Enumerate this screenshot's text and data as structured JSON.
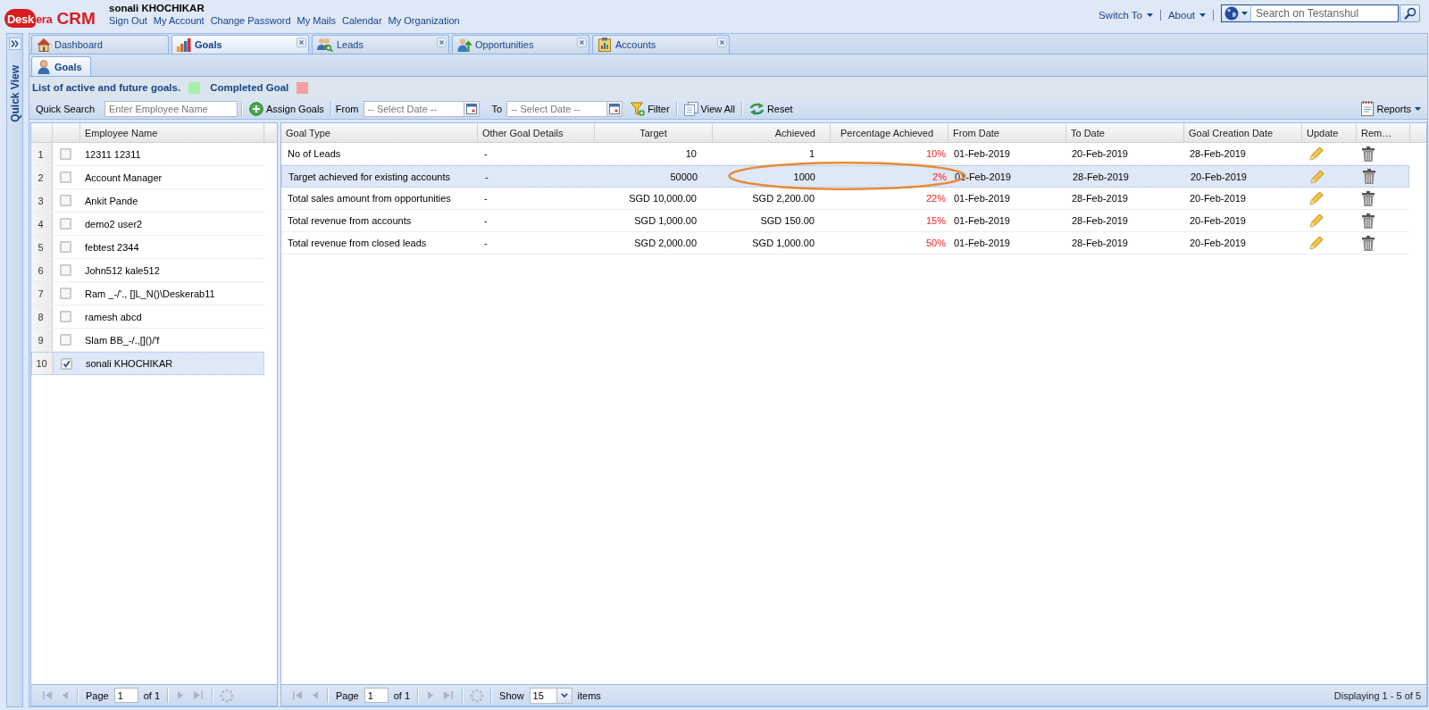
{
  "header": {
    "logo_mark": "Desk",
    "logo_text": "era",
    "product": "CRM",
    "user": "sonali KHOCHIKAR",
    "links": [
      "Sign Out",
      "My Account",
      "Change Password",
      "My Mails",
      "Calendar",
      "My Organization"
    ],
    "menus": [
      "Switch To",
      "About"
    ],
    "search": {
      "placeholder": "Search on Testanshul"
    }
  },
  "quick_view": {
    "title": "Quick View"
  },
  "tabs": [
    {
      "label": "Dashboard",
      "kind": "house",
      "closable": false,
      "selected": false
    },
    {
      "label": "Goals",
      "kind": "bar-chart",
      "closable": true,
      "selected": true
    },
    {
      "label": "Leads",
      "kind": "people",
      "closable": true,
      "selected": false
    },
    {
      "label": "Opportunities",
      "kind": "person-arrow",
      "closable": true,
      "selected": false
    },
    {
      "label": "Accounts",
      "kind": "clipboard",
      "closable": true,
      "selected": false
    }
  ],
  "subtabs": [
    {
      "label": "Goals",
      "selected": true
    }
  ],
  "legend": [
    {
      "label": "List of active and future goals.",
      "color": "#a8f0a8"
    },
    {
      "label": "Completed Goal",
      "color": "#f2a0a0"
    }
  ],
  "toolbar": {
    "search_label": "Quick Search",
    "search_placeholder": "Enter Employee Name",
    "assign": "Assign Goals",
    "from_label": "From",
    "from_placeholder": "-- Select Date --",
    "to_label": "To",
    "to_placeholder": "-- Select Date --",
    "filter": "Filter",
    "view_all": "View All",
    "reset": "Reset",
    "reports": "Reports"
  },
  "employees": {
    "columns": [
      "Employee Name"
    ],
    "rows": [
      {
        "number": "1",
        "name": "12311 12311",
        "checked": false,
        "selected": false
      },
      {
        "number": "2",
        "name": "Account Manager",
        "checked": false,
        "selected": false
      },
      {
        "number": "3",
        "name": "Ankit Pande",
        "checked": false,
        "selected": false
      },
      {
        "number": "4",
        "name": "demo2 user2",
        "checked": false,
        "selected": false
      },
      {
        "number": "5",
        "name": "febtest 2344",
        "checked": false,
        "selected": false
      },
      {
        "number": "6",
        "name": "John512 kale512",
        "checked": false,
        "selected": false
      },
      {
        "number": "7",
        "name": "Ram _-/'., []L_N()\\Deskerab11",
        "checked": false,
        "selected": false
      },
      {
        "number": "8",
        "name": "ramesh abcd",
        "checked": false,
        "selected": false
      },
      {
        "number": "9",
        "name": "Slam BB_-/.,[]()/'f",
        "checked": false,
        "selected": false
      },
      {
        "number": "10",
        "name": "sonali KHOCHIKAR",
        "checked": true,
        "selected": true
      }
    ],
    "pager": {
      "page_label": "Page",
      "page": "1",
      "of": "of 1",
      "nav_disabled": true
    }
  },
  "goals": {
    "columns": [
      "Goal Type",
      "Other Goal Details",
      "Target",
      "Achieved",
      "Percentage Achieved",
      "From Date",
      "To Date",
      "Goal Creation Date",
      "Update",
      "Rem…"
    ],
    "rows": [
      {
        "cells": [
          "No of Leads",
          "-",
          "10",
          "1",
          "10%",
          "01-Feb-2019",
          "20-Feb-2019",
          "28-Feb-2019"
        ],
        "selected": false,
        "circled": false
      },
      {
        "cells": [
          "Target achieved for existing accounts",
          "-",
          "50000",
          "1000",
          "2%",
          "01-Feb-2019",
          "28-Feb-2019",
          "20-Feb-2019"
        ],
        "selected": true,
        "circled": true
      },
      {
        "cells": [
          "Total sales amount from opportunities",
          "-",
          "SGD 10,000.00",
          "SGD 2,200.00",
          "22%",
          "01-Feb-2019",
          "28-Feb-2019",
          "20-Feb-2019"
        ],
        "selected": false,
        "circled": false
      },
      {
        "cells": [
          "Total revenue from accounts",
          "-",
          "SGD 1,000.00",
          "SGD 150.00",
          "15%",
          "01-Feb-2019",
          "28-Feb-2019",
          "20-Feb-2019"
        ],
        "selected": false,
        "circled": false
      },
      {
        "cells": [
          "Total revenue from closed leads",
          "-",
          "SGD 2,000.00",
          "SGD 1,000.00",
          "50%",
          "01-Feb-2019",
          "28-Feb-2019",
          "20-Feb-2019"
        ],
        "selected": false,
        "circled": false
      }
    ],
    "pager": {
      "page_label": "Page",
      "page": "1",
      "of": "of 1",
      "nav_disabled": true,
      "show_label": "Show",
      "page_size": "15",
      "items_label": "items",
      "display": "Displaying 1 - 5 of 5"
    }
  }
}
